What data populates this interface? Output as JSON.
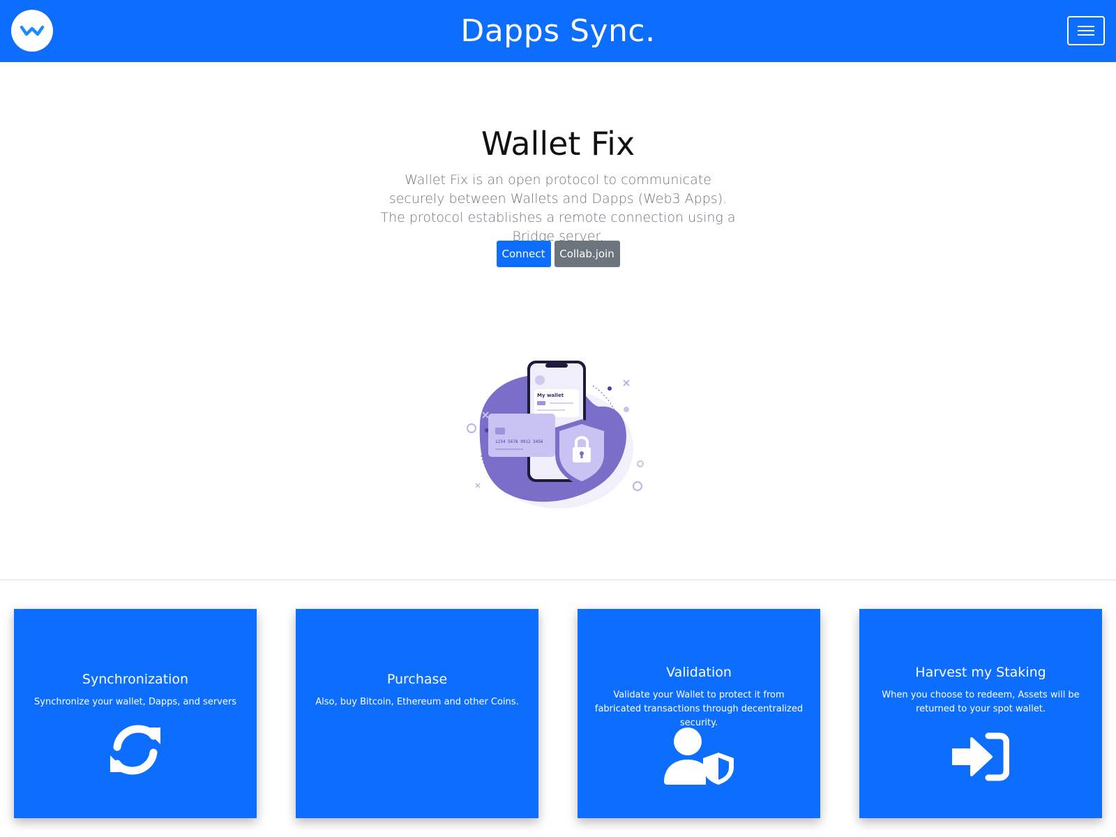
{
  "navbar": {
    "brand": "Dapps Sync.",
    "logo_icon": "walletconnect-logo-icon",
    "menu_icon": "hamburger-menu-icon"
  },
  "hero": {
    "title": "Wallet Fix",
    "description": "Wallet Fix is an open protocol to communicate securely between Wallets and Dapps (Web3 Apps). The protocol establishes a remote connection using a Bridge server.",
    "connect_label": "Connect",
    "collab_label": "Collab.join",
    "illustration": {
      "label": "My wallet",
      "card_number": "1234 5678 9012 3456",
      "icon": "phone-wallet-shield-illustration"
    }
  },
  "cards": [
    {
      "title": "Synchronization",
      "text": "Synchronize your wallet, Dapps, and servers",
      "icon": "sync-icon"
    },
    {
      "title": "Purchase",
      "text": "Also, buy Bitcoin, Ethereum and other Coins.",
      "icon": ""
    },
    {
      "title": "Validation",
      "text": "Validate your Wallet to protect it from fabricated transactions through decentralized security.",
      "icon": "user-shield-icon"
    },
    {
      "title": "Harvest my Staking",
      "text": "When you choose to redeem, Assets will be returned to your spot wallet.",
      "icon": "sign-in-icon"
    }
  ],
  "colors": {
    "primary": "#0d6efd",
    "secondary": "#6c757d",
    "illustration_purple": "#7a6fc8"
  }
}
